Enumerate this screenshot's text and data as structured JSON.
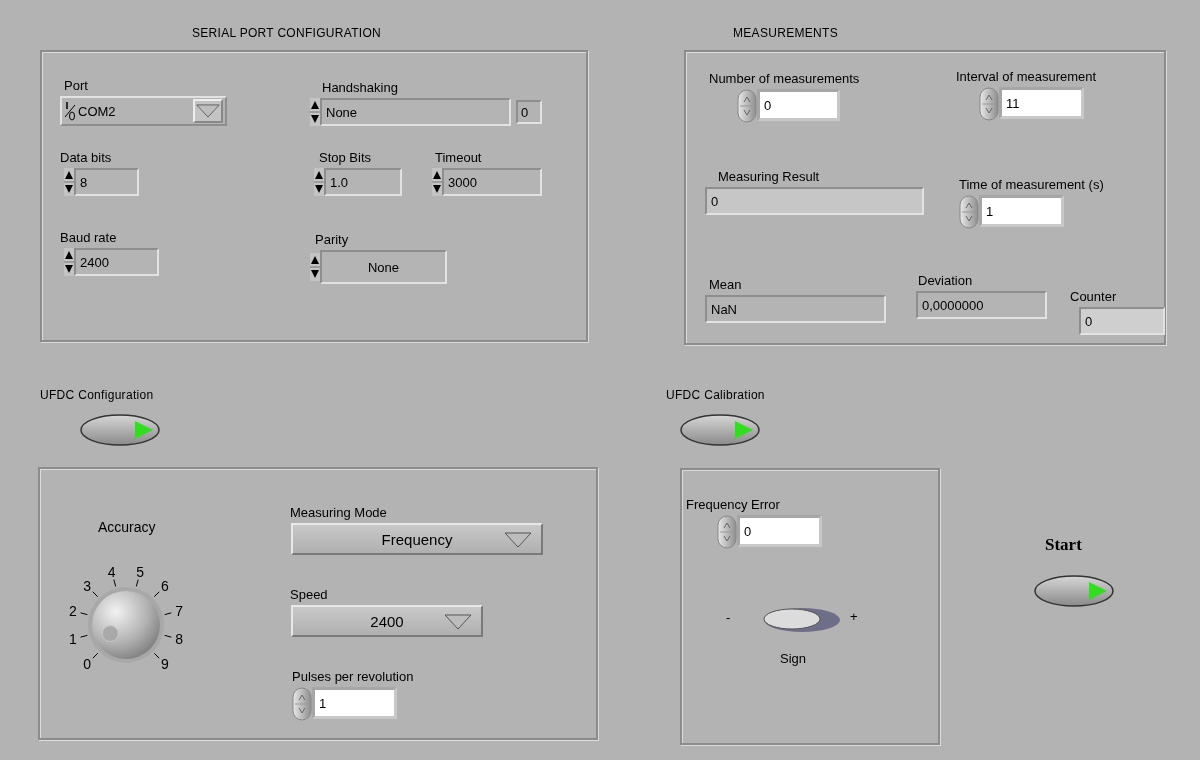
{
  "serial_port_configuration": {
    "title": "SERIAL PORT CONFIGURATION",
    "controls": [
      {
        "kind": "io_ring",
        "label": "Port",
        "value": "COM2"
      },
      {
        "kind": "enum_indexed",
        "label": "Handshaking",
        "value": "None",
        "index": "0"
      },
      {
        "kind": "numeric",
        "label": "Data bits",
        "value": "8"
      },
      {
        "kind": "numeric",
        "label": "Stop Bits",
        "value": "1.0"
      },
      {
        "kind": "numeric",
        "label": "Timeout",
        "value": "3000"
      },
      {
        "kind": "numeric",
        "label": "Baud rate",
        "value": "2400"
      },
      {
        "kind": "enum_centered",
        "label": "Parity",
        "value": "None"
      }
    ]
  },
  "measurements": {
    "title": "MEASUREMENTS",
    "controls": [
      {
        "kind": "spin_control",
        "label": "Number of measurements",
        "value": "0"
      },
      {
        "kind": "spin_control",
        "label": "Interval of measurement",
        "value": "11"
      },
      {
        "kind": "indicator",
        "label": "Measuring Result",
        "value": "0"
      },
      {
        "kind": "spin_control",
        "label": "Time of measurement (s)",
        "value": "1"
      },
      {
        "kind": "indicator",
        "label": "Mean",
        "value": "NaN"
      },
      {
        "kind": "indicator",
        "label": "Deviation",
        "value": "0,0000000"
      },
      {
        "kind": "indicator",
        "label": "Counter",
        "value": "0"
      }
    ]
  },
  "ufdc_configuration": {
    "button_label": "UFDC Configuration",
    "accuracy": {
      "label": "Accuracy",
      "scale": [
        "0",
        "1",
        "2",
        "3",
        "4",
        "5",
        "6",
        "7",
        "8",
        "9"
      ]
    },
    "controls": [
      {
        "kind": "dropdown",
        "label": "Measuring Mode",
        "value": "Frequency"
      },
      {
        "kind": "dropdown",
        "label": "Speed",
        "value": "2400"
      },
      {
        "kind": "spin_control",
        "label": "Pulses per revolution",
        "value": "1"
      }
    ]
  },
  "ufdc_calibration": {
    "button_label": "UFDC Calibration",
    "controls": [
      {
        "kind": "spin_control",
        "label": "Frequency Error",
        "value": "0"
      }
    ],
    "sign": {
      "label": "Sign",
      "minus": "-",
      "plus": "+",
      "on": false
    }
  },
  "start": {
    "label": "Start"
  }
}
